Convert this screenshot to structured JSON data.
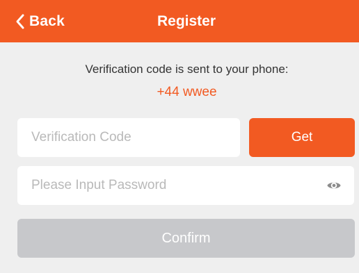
{
  "header": {
    "back_label": "Back",
    "back_icon": "chevron-left-icon",
    "title": "Register"
  },
  "message": {
    "text": "Verification code is sent to your phone:",
    "phone": "+44 wwee"
  },
  "code_field": {
    "placeholder": "Verification Code",
    "value": ""
  },
  "get_button": {
    "label": "Get"
  },
  "password_field": {
    "placeholder": "Please Input Password",
    "value": "",
    "toggle_icon": "eye-icon"
  },
  "confirm_button": {
    "label": "Confirm",
    "enabled": false
  },
  "colors": {
    "accent": "#f25a22",
    "background": "#efefef",
    "disabled_button": "#c7c8cb",
    "placeholder": "#b9b9b9"
  }
}
